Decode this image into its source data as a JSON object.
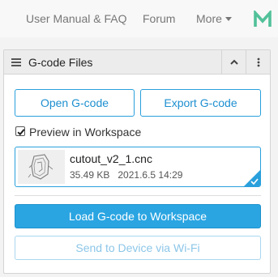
{
  "nav": {
    "links": [
      "User Manual & FAQ",
      "Forum",
      "More"
    ],
    "logo_letter": "M",
    "logo_color": "#52c19a"
  },
  "panel": {
    "title": "G-code Files",
    "open_button": "Open G-code",
    "export_button": "Export G-code",
    "preview_label": "Preview in Workspace",
    "preview_checked": true,
    "file": {
      "name": "cutout_v2_1.cnc",
      "size": "35.49 KB",
      "date": "2021.6.5 14:29",
      "selected": true
    },
    "load_button": "Load G-code to Workspace",
    "send_button": "Send to Device via Wi-Fi",
    "send_disabled": true
  },
  "colors": {
    "accent": "#29a0dc",
    "primary_button": "#2aa5e2",
    "disabled_text": "#8cc6e8"
  }
}
